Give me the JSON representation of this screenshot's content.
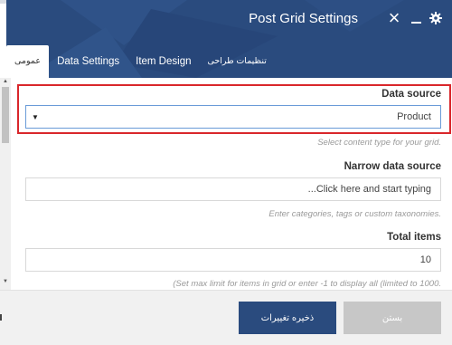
{
  "dialog": {
    "title": "Post Grid Settings",
    "header_color": "#2a4b7e",
    "icons": [
      "close-icon",
      "minimize-icon",
      "gear-icon"
    ]
  },
  "tabs": [
    {
      "label": "عمومی",
      "active": true
    },
    {
      "label": "Data Settings",
      "active": false
    },
    {
      "label": "Item Design",
      "active": false
    },
    {
      "label": "تنظیمات طراحی",
      "active": false
    }
  ],
  "form": {
    "data_source": {
      "label": "Data source",
      "value": "Product",
      "hint": "Select content type for your grid.",
      "highlight_color": "#d9272b"
    },
    "narrow_data_source": {
      "label": "Narrow data source",
      "placeholder": "...Click here and start typing",
      "hint": "Enter categories, tags or custom taxonomies."
    },
    "total_items": {
      "label": "Total items",
      "value": "10",
      "hint": "(Set max limit for items in grid or enter -1 to display all (limited to 1000."
    }
  },
  "footer": {
    "save_label": "ذخیره تغییرات",
    "close_label": "بستن"
  }
}
